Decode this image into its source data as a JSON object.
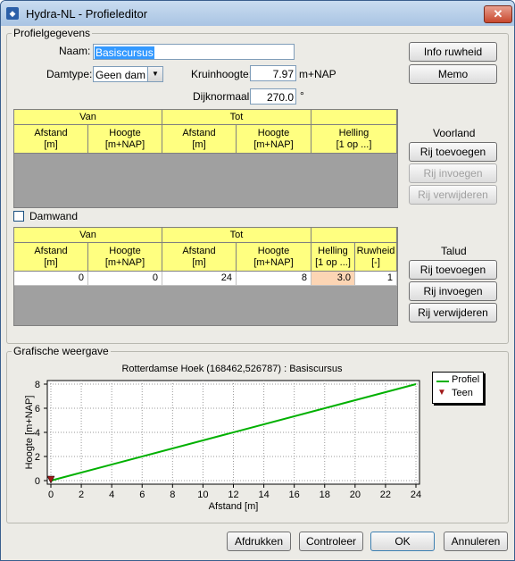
{
  "window": {
    "title": "Hydra-NL - Profieleditor"
  },
  "profiel": {
    "group_title": "Profielgegevens",
    "naam_label": "Naam:",
    "naam_value": "Basiscursus",
    "damtype_label": "Damtype:",
    "damtype_value": "Geen dam",
    "kruinhoogte_label": "Kruinhoogte:",
    "kruinhoogte_value": "7.97",
    "kruinhoogte_unit": "m+NAP",
    "dijknormaal_label": "Dijknormaal:",
    "dijknormaal_value": "270.0",
    "dijknormaal_unit": "°",
    "info_ruwheid_button": "Info ruwheid",
    "memo_button": "Memo"
  },
  "voorland": {
    "title": "Voorland",
    "group_headers": [
      "Van",
      "Tot",
      ""
    ],
    "columns": [
      "Afstand\n[m]",
      "Hoogte\n[m+NAP]",
      "Afstand\n[m]",
      "Hoogte\n[m+NAP]",
      "Helling\n[1 op ...]"
    ],
    "rows": [],
    "add_button": "Rij toevoegen",
    "insert_button": "Rij invoegen",
    "delete_button": "Rij verwijderen"
  },
  "damwand": {
    "label": "Damwand",
    "checked": false
  },
  "talud": {
    "title": "Talud",
    "group_headers": [
      "Van",
      "Tot",
      ""
    ],
    "columns": [
      "Afstand\n[m]",
      "Hoogte\n[m+NAP]",
      "Afstand\n[m]",
      "Hoogte\n[m+NAP]",
      "Helling\n[1 op ...]",
      "Ruwheid\n[-]"
    ],
    "rows": [
      [
        "0",
        "0",
        "24",
        "8",
        "3.0",
        "1"
      ]
    ],
    "add_button": "Rij toevoegen",
    "insert_button": "Rij invoegen",
    "delete_button": "Rij verwijderen"
  },
  "grafisch": {
    "group_title": "Grafische weergave"
  },
  "chart_data": {
    "type": "line",
    "title": "Rotterdamse Hoek (168462,526787) : Basiscursus",
    "xlabel": "Afstand [m]",
    "ylabel": "Hoogte [m+NAP]",
    "xlim": [
      0,
      24
    ],
    "ylim": [
      0,
      8
    ],
    "xticks": [
      "0",
      "2",
      "4",
      "6",
      "8",
      "10",
      "12",
      "14",
      "16",
      "18",
      "20",
      "22",
      "24"
    ],
    "yticks": [
      "0",
      "2",
      "4",
      "6",
      "8"
    ],
    "grid": true,
    "legend_position": "top-right",
    "series": [
      {
        "name": "Profiel",
        "color": "#00b000",
        "x": [
          0,
          24
        ],
        "y": [
          0,
          8
        ]
      },
      {
        "name": "Teen",
        "color": "#a01818",
        "marker": "triangle-down",
        "x": [
          0
        ],
        "y": [
          0
        ]
      }
    ]
  },
  "footer": {
    "print_button": "Afdrukken",
    "check_button": "Controleer",
    "ok_button": "OK",
    "cancel_button": "Annuleren"
  }
}
